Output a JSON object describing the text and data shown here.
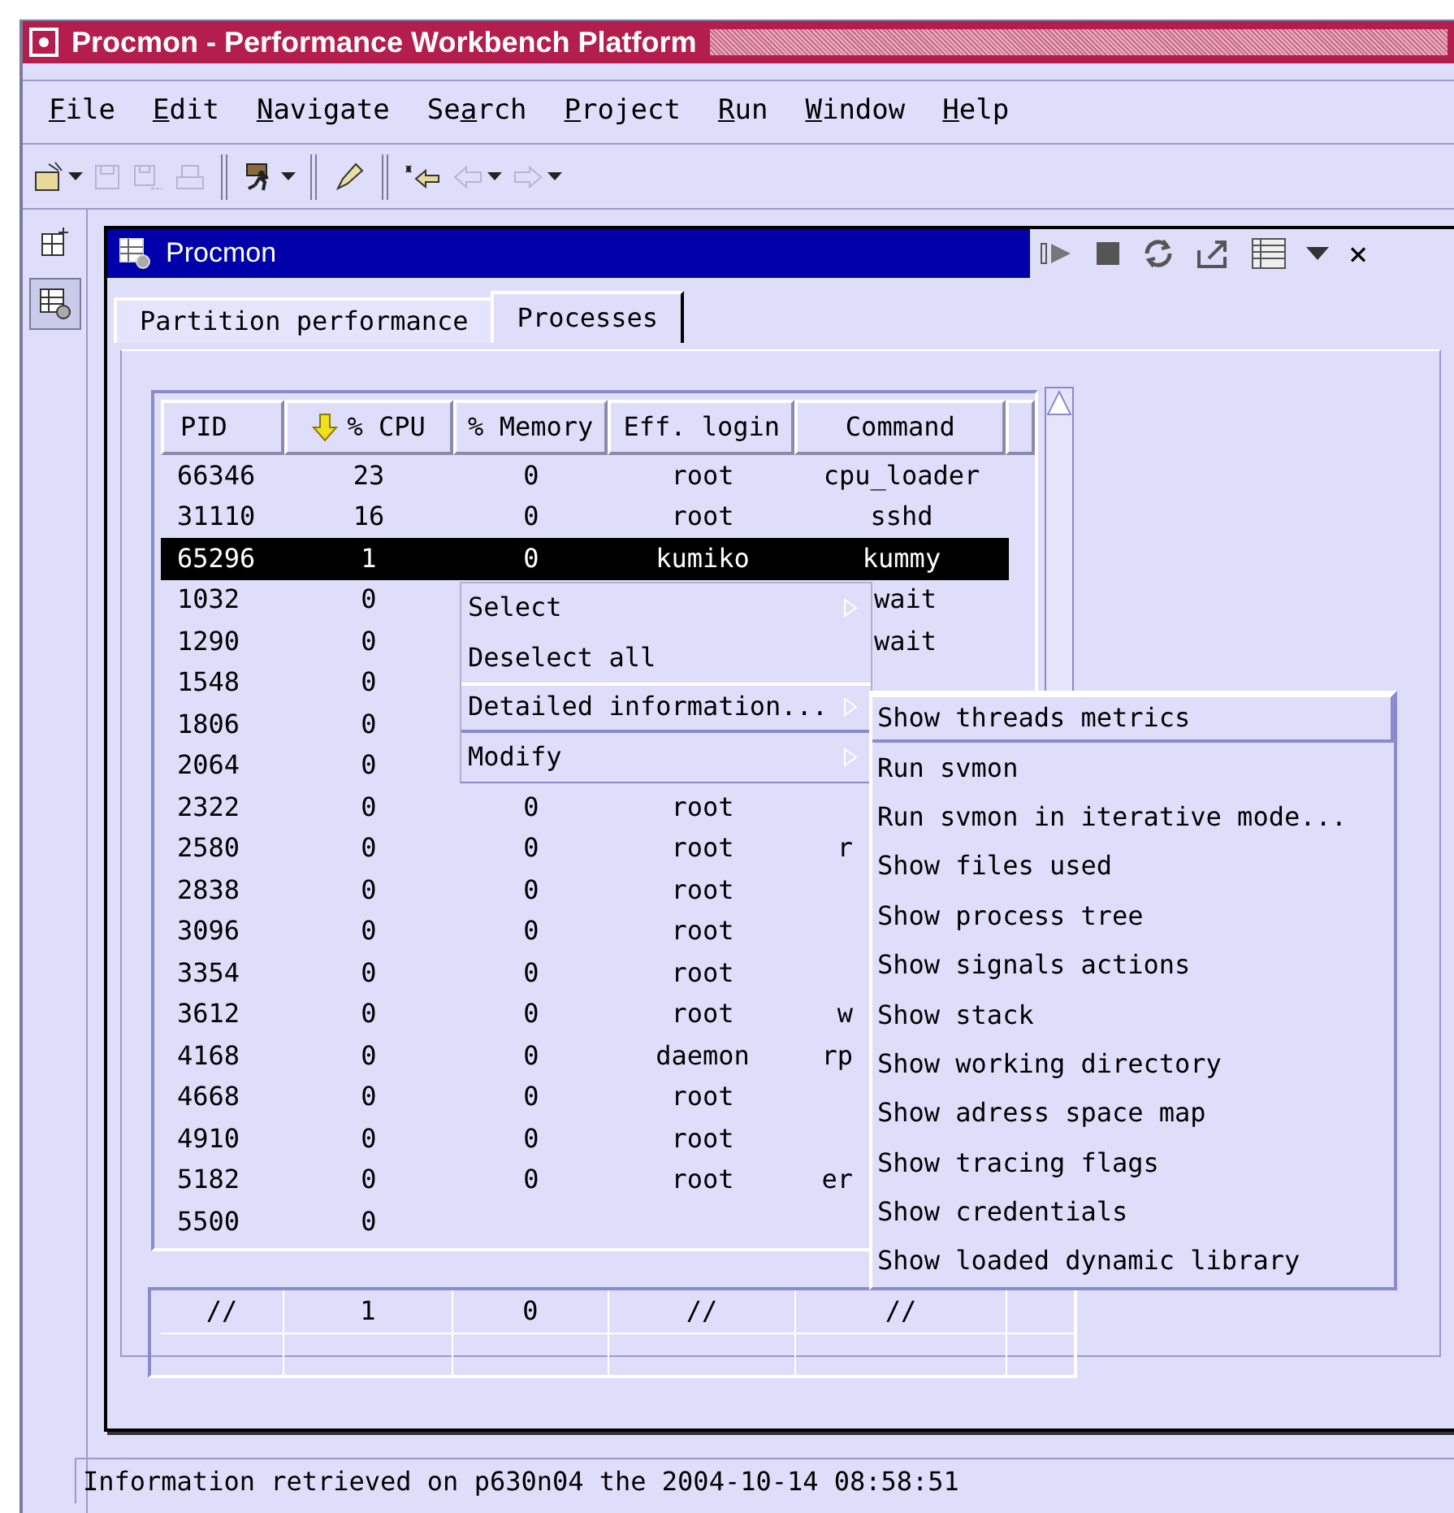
{
  "window": {
    "title": "Procmon - Performance Workbench Platform"
  },
  "menu_bar": [
    {
      "key": "F",
      "rest": "ile"
    },
    {
      "key": "E",
      "rest": "dit"
    },
    {
      "key": "N",
      "rest": "avigate"
    },
    {
      "pre": "Se",
      "key": "a",
      "rest": "rch"
    },
    {
      "key": "P",
      "rest": "roject"
    },
    {
      "key": "R",
      "rest": "un"
    },
    {
      "key": "W",
      "rest": "indow"
    },
    {
      "key": "H",
      "rest": "elp"
    }
  ],
  "toolbar": [
    {
      "kind": "new",
      "disabled": false,
      "dropdown": true
    },
    {
      "kind": "save",
      "disabled": true,
      "dropdown": false
    },
    {
      "kind": "save-all",
      "disabled": true,
      "dropdown": false
    },
    {
      "kind": "print",
      "disabled": true,
      "dropdown": false
    },
    {
      "kind": "sep"
    },
    {
      "kind": "run",
      "disabled": false,
      "dropdown": true
    },
    {
      "kind": "sep"
    },
    {
      "kind": "pen",
      "disabled": false,
      "dropdown": false
    },
    {
      "kind": "sep"
    },
    {
      "kind": "last-edit",
      "disabled": false,
      "dropdown": false
    },
    {
      "kind": "back",
      "disabled": true,
      "dropdown": true
    },
    {
      "kind": "forward",
      "disabled": true,
      "dropdown": true
    }
  ],
  "view": {
    "title": "Procmon",
    "close": "×",
    "tabs": [
      {
        "label": "Partition performance",
        "selected": false
      },
      {
        "label": "Processes",
        "selected": true
      }
    ],
    "table": {
      "columns": [
        {
          "label": "PID",
          "sorted": false
        },
        {
          "label": "% CPU",
          "sorted": true
        },
        {
          "label": "% Memory",
          "sorted": false
        },
        {
          "label": "Eff. login",
          "sorted": false
        },
        {
          "label": "Command",
          "sorted": false
        }
      ],
      "rows": [
        {
          "kind": "full",
          "pid": "66346",
          "cpu": "23",
          "memory": "0",
          "login": "root",
          "command": "cpu_loader",
          "selected": false
        },
        {
          "kind": "full",
          "pid": "31110",
          "cpu": "16",
          "memory": "0",
          "login": "root",
          "command": "sshd",
          "selected": false
        },
        {
          "kind": "full",
          "pid": "65296",
          "cpu": "1",
          "memory": "0",
          "login": "kumiko",
          "command": "kummy",
          "selected": true
        },
        {
          "kind": "tail",
          "pid": "1032",
          "cpu": "0",
          "command": "wait",
          "selected": false
        },
        {
          "kind": "tail",
          "pid": "1290",
          "cpu": "0",
          "command": "wait",
          "selected": false
        },
        {
          "kind": "full",
          "pid": "1548",
          "cpu": "0",
          "selected": false
        },
        {
          "kind": "full",
          "pid": "1806",
          "cpu": "0",
          "selected": false
        },
        {
          "kind": "full",
          "pid": "2064",
          "cpu": "0",
          "selected": false
        },
        {
          "kind": "full",
          "pid": "2322",
          "cpu": "0",
          "memory": "0",
          "login": "root",
          "selected": false
        },
        {
          "kind": "head",
          "pid": "2580",
          "cpu": "0",
          "memory": "0",
          "login": "root",
          "command": "r",
          "selected": false
        },
        {
          "kind": "full",
          "pid": "2838",
          "cpu": "0",
          "memory": "0",
          "login": "root",
          "selected": false
        },
        {
          "kind": "full",
          "pid": "3096",
          "cpu": "0",
          "memory": "0",
          "login": "root",
          "selected": false
        },
        {
          "kind": "full",
          "pid": "3354",
          "cpu": "0",
          "memory": "0",
          "login": "root",
          "selected": false
        },
        {
          "kind": "head",
          "pid": "3612",
          "cpu": "0",
          "memory": "0",
          "login": "root",
          "command": "w",
          "selected": false
        },
        {
          "kind": "head",
          "pid": "4168",
          "cpu": "0",
          "memory": "0",
          "login": "daemon",
          "command": "rp",
          "selected": false
        },
        {
          "kind": "full",
          "pid": "4668",
          "cpu": "0",
          "memory": "0",
          "login": "root",
          "selected": false
        },
        {
          "kind": "full",
          "pid": "4910",
          "cpu": "0",
          "memory": "0",
          "login": "root",
          "selected": false
        },
        {
          "kind": "head",
          "pid": "5182",
          "cpu": "0",
          "memory": "0",
          "login": "root",
          "command": "er",
          "selected": false
        },
        {
          "kind": "full",
          "pid": "5500",
          "cpu": "0",
          "selected": false
        }
      ]
    },
    "totals": [
      "//",
      "1",
      "0",
      "//",
      "//"
    ]
  },
  "context_menu": [
    {
      "label": "Select",
      "kind": "submenu",
      "selected": false
    },
    {
      "label": "Deselect all",
      "kind": "action",
      "selected": false
    },
    {
      "label": "Detailed information...",
      "kind": "submenu",
      "selected": true
    },
    {
      "label": "Modify",
      "kind": "submenu",
      "selected": false
    }
  ],
  "submenu": [
    {
      "label": "Show threads metrics",
      "selected": true
    },
    {
      "label": "Run svmon",
      "selected": false
    },
    {
      "label": "Run svmon in iterative mode...",
      "selected": false
    },
    {
      "label": "Show files used",
      "selected": false
    },
    {
      "label": "Show process tree",
      "selected": false
    },
    {
      "label": "Show signals actions",
      "selected": false
    },
    {
      "label": "Show stack",
      "selected": false
    },
    {
      "label": "Show working directory",
      "selected": false
    },
    {
      "label": "Show adress space map",
      "selected": false
    },
    {
      "label": "Show tracing flags",
      "selected": false
    },
    {
      "label": "Show credentials",
      "selected": false
    },
    {
      "label": "Show loaded dynamic library",
      "selected": false
    }
  ],
  "status_bar": "Information retrieved on p630n04 the 2004-10-14 08:58:51"
}
